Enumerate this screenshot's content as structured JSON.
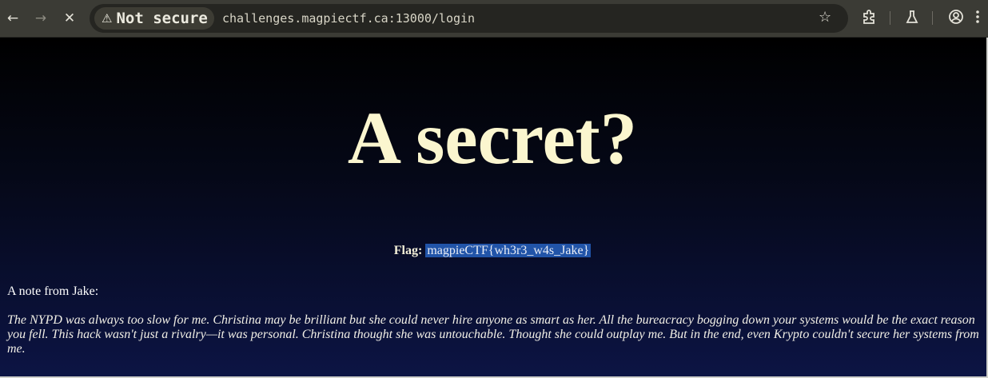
{
  "browser": {
    "security_label": "Not secure",
    "url": "challenges.magpiectf.ca:13000/login",
    "icons": [
      "back-arrow-icon",
      "forward-arrow-icon",
      "stop-loading-icon",
      "warning-icon",
      "bookmark-star-icon",
      "extensions-icon",
      "labs-flask-icon",
      "profile-icon"
    ]
  },
  "page": {
    "title": "A secret?",
    "flag_label": "Flag:",
    "flag_value": "magpieCTF{wh3r3_w4s_Jake}",
    "note_title": "A note from Jake:",
    "note_body": "The NYPD was always too slow for me. Christina may be brilliant but she could never hire anyone as smart as her. All the bureacracy bogging down your systems would be the exact reason you fell. This hack wasn't just a rivalry—it was personal. Christina thought she was untouchable. Thought she could outplay me. But in the end, even Krypto couldn't secure her systems from me."
  },
  "colors": {
    "title": "#fbf6cf",
    "flag_highlight": "#2154a8",
    "browser_bar": "#3b3b35"
  }
}
